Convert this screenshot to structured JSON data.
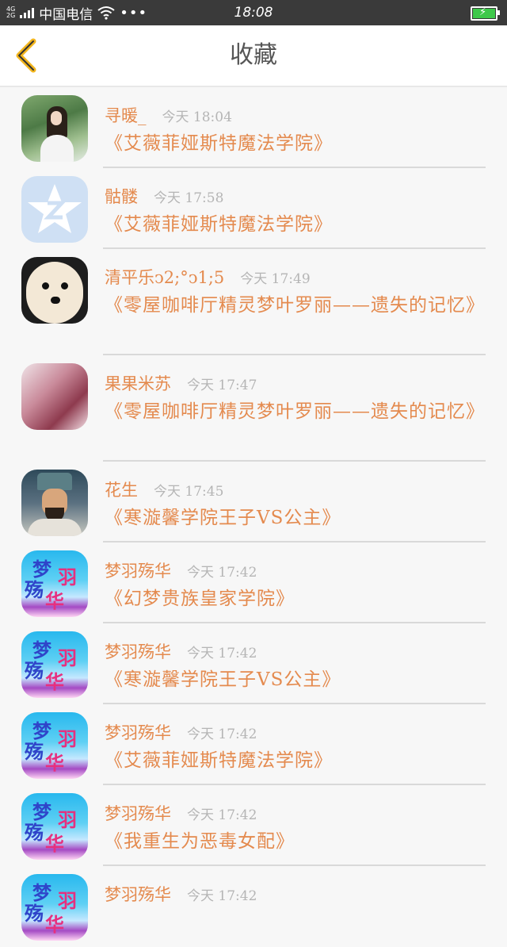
{
  "status_bar": {
    "network_top": "4G",
    "network_bottom": "2G",
    "carrier": "中国电信",
    "more": "•••",
    "time": "18:08"
  },
  "header": {
    "title": "收藏",
    "back_icon": "chevron-left-icon",
    "accent_color": "#f2b51d"
  },
  "colors": {
    "username": "#e48a4e",
    "title": "#e48a4e",
    "time": "#b5b5b5"
  },
  "favorites": [
    {
      "user": "寻暖_",
      "time": "今天 18:04",
      "title": "《艾薇菲娅斯特魔法学院》",
      "avatar": "girl-photo-avatar"
    },
    {
      "user": "骷髅",
      "time": "今天 17:58",
      "title": "《艾薇菲娅斯特魔法学院》",
      "avatar": "qq-star-avatar"
    },
    {
      "user": "清平乐ↄ2;°ↄ1;5",
      "time": "今天 17:49",
      "title": "《零屋咖啡厅精灵梦叶罗丽——遗失的记忆》",
      "avatar": "dog-avatar"
    },
    {
      "user": "果果米苏",
      "time": "今天 17:47",
      "title": "《零屋咖啡厅精灵梦叶罗丽——遗失的记忆》",
      "avatar": "anime-girl-avatar"
    },
    {
      "user": "花生",
      "time": "今天 17:45",
      "title": "《寒漩馨学院王子VS公主》",
      "avatar": "warrior-avatar"
    },
    {
      "user": "梦羽殇华",
      "time": "今天 17:42",
      "title": "《幻梦贵族皇家学院》",
      "avatar": "mengyu-avatar",
      "avatar_text": [
        "梦",
        "羽",
        "殇",
        "华"
      ]
    },
    {
      "user": "梦羽殇华",
      "time": "今天 17:42",
      "title": "《寒漩馨学院王子VS公主》",
      "avatar": "mengyu-avatar",
      "avatar_text": [
        "梦",
        "羽",
        "殇",
        "华"
      ]
    },
    {
      "user": "梦羽殇华",
      "time": "今天 17:42",
      "title": "《艾薇菲娅斯特魔法学院》",
      "avatar": "mengyu-avatar",
      "avatar_text": [
        "梦",
        "羽",
        "殇",
        "华"
      ]
    },
    {
      "user": "梦羽殇华",
      "time": "今天 17:42",
      "title": "《我重生为恶毒女配》",
      "avatar": "mengyu-avatar",
      "avatar_text": [
        "梦",
        "羽",
        "殇",
        "华"
      ]
    },
    {
      "user": "梦羽殇华",
      "time": "今天 17:42",
      "title": "",
      "avatar": "mengyu-avatar",
      "avatar_text": [
        "梦",
        "羽",
        "殇",
        "华"
      ]
    }
  ]
}
